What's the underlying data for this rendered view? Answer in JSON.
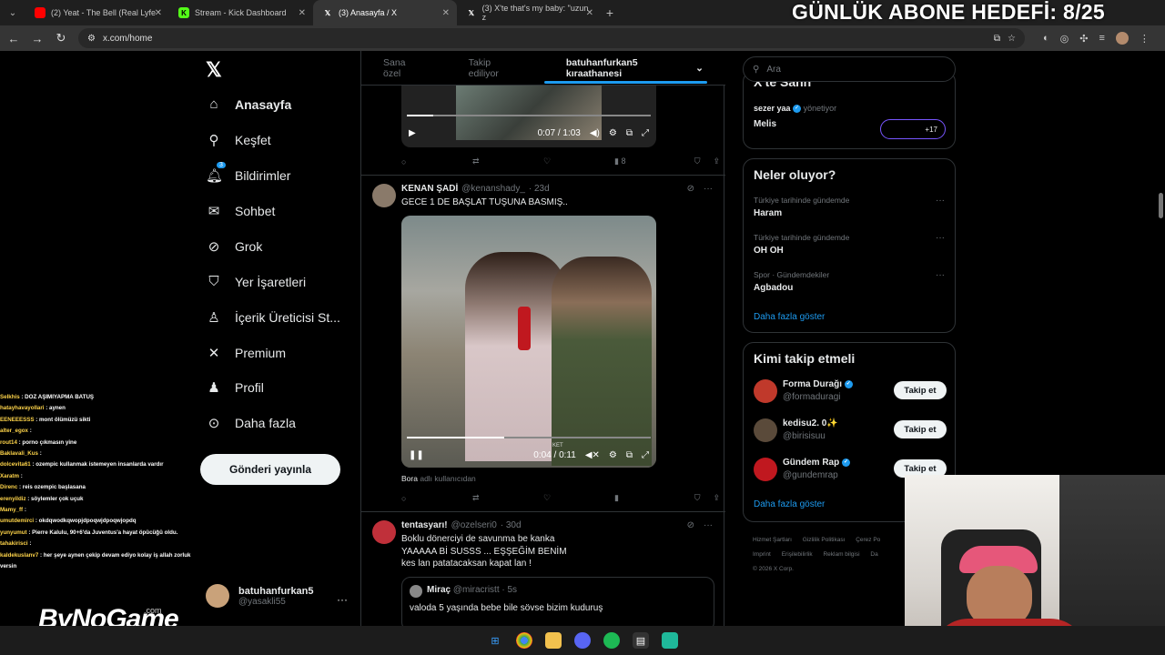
{
  "browser": {
    "tabs": [
      {
        "label": "(2) Yeat - The Bell (Real Lyfe",
        "favicon_color": "#ff0000"
      },
      {
        "label": "Stream - Kick Dashboard",
        "favicon_color": "#53fc18"
      },
      {
        "label": "(3) Anasayfa / X",
        "favicon_color": "#ffffff"
      },
      {
        "label": "(3) X'te that's my baby: \"uzun z",
        "favicon_color": "#ffffff"
      }
    ],
    "url": "x.com/home"
  },
  "overlay": {
    "goal_text": "GÜNLÜK ABONE HEDEFİ: 8/25"
  },
  "nav": {
    "items": [
      {
        "label": "Anasayfa",
        "icon": "home-icon"
      },
      {
        "label": "Keşfet",
        "icon": "search-icon"
      },
      {
        "label": "Bildirimler",
        "icon": "bell-icon",
        "badge": "3"
      },
      {
        "label": "Sohbet",
        "icon": "mail-icon"
      },
      {
        "label": "Grok",
        "icon": "grok-icon"
      },
      {
        "label": "Yer İşaretleri",
        "icon": "bookmark-icon"
      },
      {
        "label": "İçerik Üreticisi St...",
        "icon": "creator-icon"
      },
      {
        "label": "Premium",
        "icon": "x-icon"
      },
      {
        "label": "Profil",
        "icon": "person-icon"
      },
      {
        "label": "Daha fazla",
        "icon": "more-circle-icon"
      }
    ],
    "post_button": "Gönderi yayınla",
    "account": {
      "name": "batuhanfurkan5",
      "handle": "@yasakli55"
    }
  },
  "timeline": {
    "tabs": [
      "Sana özel",
      "Takip ediliyor",
      "batuhanfurkan5 kıraathanesi"
    ],
    "video1": {
      "time": "0:07 / 1:03",
      "progress": 0.11,
      "views": "8"
    },
    "tweet2": {
      "name": "KENAN ŞADİ",
      "handle": "@kenanshady_",
      "age": "· 23d",
      "text": "GECE 1 DE BAŞLAT TUŞUNA BASMIŞ..",
      "video_time": "0:04 / 0:11",
      "video_progress": 0.4,
      "video_label": "KET",
      "source_name": "Bora",
      "source_suffix": "adlı kullanıcıdan"
    },
    "tweet3": {
      "name": "tentasyarı!",
      "handle": "@ozelseri0",
      "age": "· 30d",
      "lines": [
        "Boklu dönerciyi de savunma be kanka",
        "YAAAAA Bİ SUSSS ... EŞŞEĞİM BENİM",
        "kes lan patatacaksan kapat lan !"
      ],
      "quote": {
        "name": "Miraç",
        "handle": "@miracristt",
        "age": "· 5s",
        "text": "valoda 5 yaşında bebe bile sövse bizim kuduruş"
      }
    }
  },
  "sidebar": {
    "search_placeholder": "Ara",
    "community": {
      "title": "X'te Sahn",
      "user": "sezer yaa",
      "role": "yönetiyor",
      "name": "Melis",
      "count": "+17"
    },
    "trends": {
      "title": "Neler oluyor?",
      "items": [
        {
          "category": "Türkiye tarihinde gündemde",
          "name": "Haram"
        },
        {
          "category": "Türkiye tarihinde gündemde",
          "name": "OH OH"
        },
        {
          "category": "Spor · Gündemdekiler",
          "name": "Agbadou"
        }
      ],
      "show_more": "Daha fazla göster"
    },
    "follow": {
      "title": "Kimi takip etmeli",
      "items": [
        {
          "name": "Forma Durağı",
          "handle": "@formaduragi",
          "verified": true,
          "color": "#c0392b"
        },
        {
          "name": "kedisu2. 0✨",
          "handle": "@birisisuu",
          "verified": false,
          "color": "#5a4a3a"
        },
        {
          "name": "Gündem Rap",
          "handle": "@gundemrap",
          "verified": true,
          "color": "#c0181f"
        }
      ],
      "button": "Takip et",
      "show_more": "Daha fazla göster"
    },
    "footer": [
      "Hizmet Şartları",
      "Gizlilik Politikası",
      "Çerez Po",
      "Imprint",
      "Erişilebilirlik",
      "Reklam bilgisi",
      "Da",
      "© 2026 X Corp."
    ]
  },
  "chat": [
    {
      "user": "Selkhis",
      "msg": ": DOZ AŞIMIYAPMA BATUŞ"
    },
    {
      "user": "hatayhavayollari",
      "msg": ": aynen"
    },
    {
      "user": "EENEEESSS",
      "msg": ": mont ölümüzü sikti"
    },
    {
      "user": "alter_egox",
      "msg": ":"
    },
    {
      "user": "rout14",
      "msg": ": porno çıkmasın yine"
    },
    {
      "user": "Baklavali_Kus",
      "msg": ":"
    },
    {
      "user": "dolcevita61",
      "msg": ": ozempic kullanmak istemeyen insanlarda vardır"
    },
    {
      "user": "Xaratm",
      "msg": ":"
    },
    {
      "user": "Direnc",
      "msg": ": reis ozempic başlasana"
    },
    {
      "user": "erenyildiz",
      "msg": ": söylemler çok uçuk"
    },
    {
      "user": "Mamy_ff",
      "msg": ":"
    },
    {
      "user": "umutdemirci",
      "msg": ": okdqwodkqwopjdpoqwjdpoqwjopdq"
    },
    {
      "user": "yunyumut",
      "msg": ": Pierre Kalulu, 90+6'da Juventus'a hayat öpücüğü oldu."
    },
    {
      "user": "tahakirisci",
      "msg": ":"
    },
    {
      "user": "kaldekuslanv7",
      "msg": ": her şeye aynen çekip devam ediyo kolay iş allah zorluk versin"
    }
  ],
  "watermark": {
    "main": "ByNoGame",
    "sub": ".com"
  }
}
